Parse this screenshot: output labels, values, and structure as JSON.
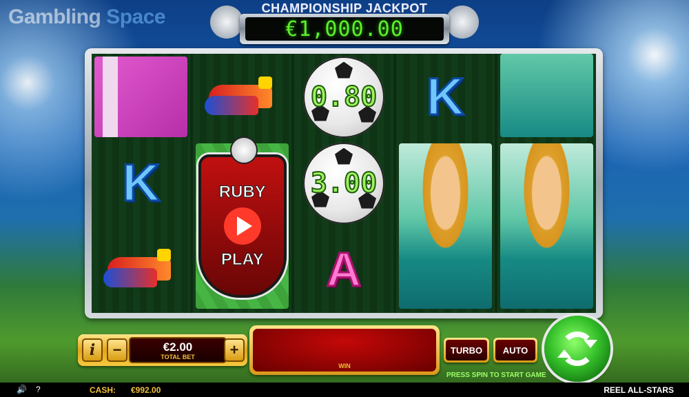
{
  "watermark": {
    "part1": "Gambling",
    "part2": "Space"
  },
  "jackpot": {
    "title": "CHAMPIONSHIP JACKPOT",
    "value": "€1,000.00"
  },
  "reels": {
    "k_letter": "K",
    "a_letter": "A",
    "ball_values": [
      "0.80",
      "3.00"
    ],
    "logo_top": "RUBY",
    "logo_bottom": "PLAY"
  },
  "controls": {
    "info": "i",
    "minus": "−",
    "plus": "+",
    "bet_value": "€2.00",
    "bet_label": "TOTAL BET",
    "win_label": "WIN",
    "turbo": "TURBO",
    "auto": "AUTO",
    "hint": "PRESS SPIN TO START GAME"
  },
  "footer": {
    "sound": "🔊",
    "help": "?",
    "cash_label": "CASH:",
    "cash_value": "€992.00",
    "game_name": "REEL ALL-STARS"
  }
}
